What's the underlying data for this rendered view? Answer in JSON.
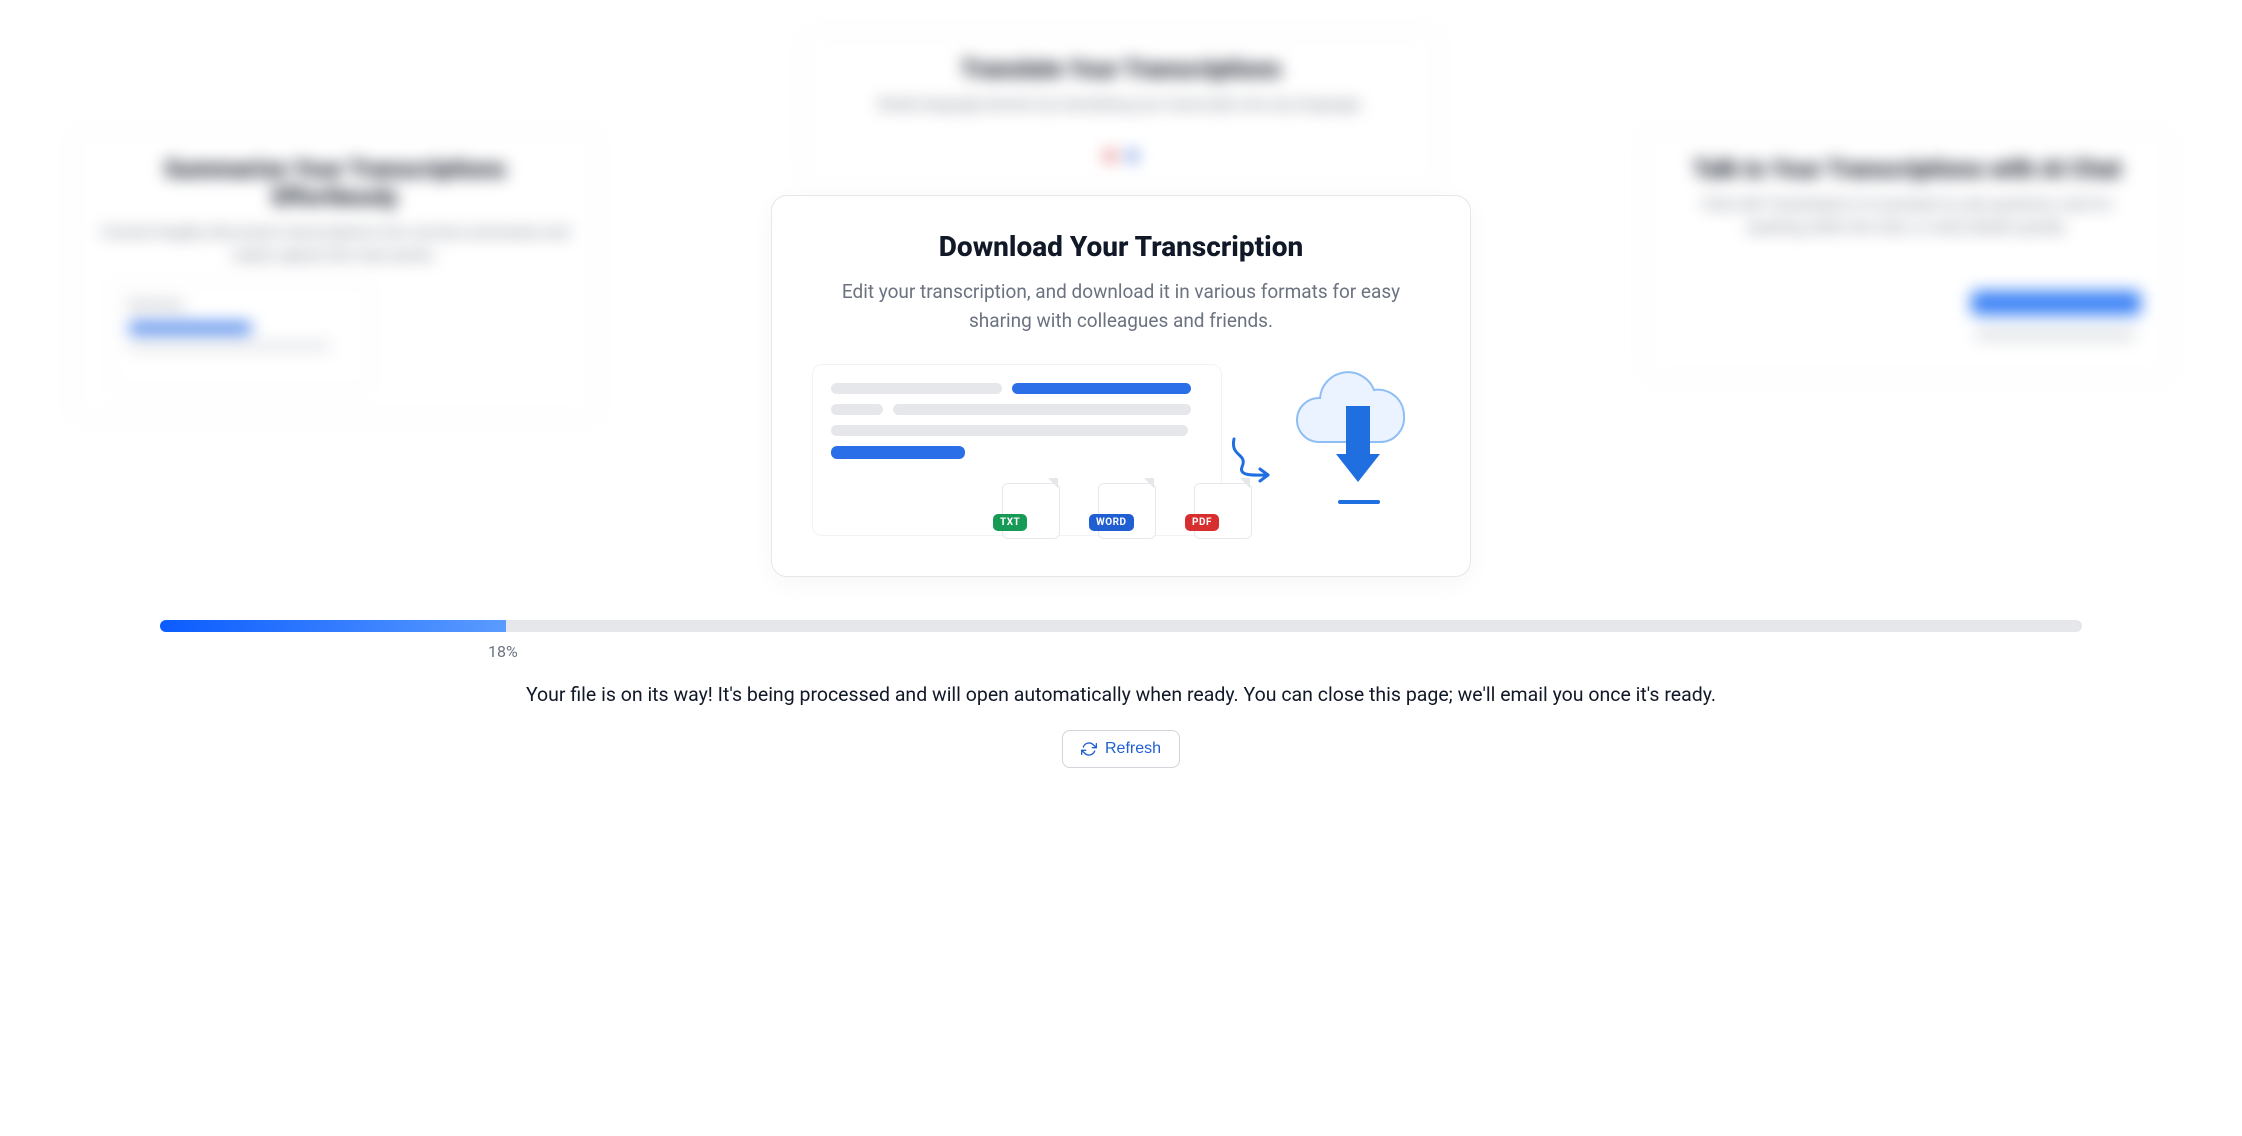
{
  "background": {
    "top": {
      "title": "Translate Your Transcriptions",
      "subtitle": "Break language barriers by translating your transcripts into any language."
    },
    "left": {
      "title": "Summarize Your Transcriptions Effortlessly",
      "subtitle": "Convert lengthy discussion transcriptions into concise summaries and easily capture the main points.",
      "panel_label": "Summary"
    },
    "right": {
      "title": "Talk to Your Transcriptions with AI Chat",
      "subtitle": "Chat with Transkriptor's AI assistant to ask questions, look for anything within the chat, or verify details quickly."
    }
  },
  "modal": {
    "title": "Download Your Transcription",
    "subtitle": "Edit your transcription, and download it in various formats for easy sharing with colleagues and friends.",
    "formats": {
      "txt": "TXT",
      "word": "WORD",
      "pdf": "PDF"
    }
  },
  "progress": {
    "percent": 18,
    "percent_text": "18%",
    "status": "Your file is on its way! It's being processed and will open automatically when ready. You can close this page; we'll email you once it's ready.",
    "refresh_label": "Refresh"
  }
}
